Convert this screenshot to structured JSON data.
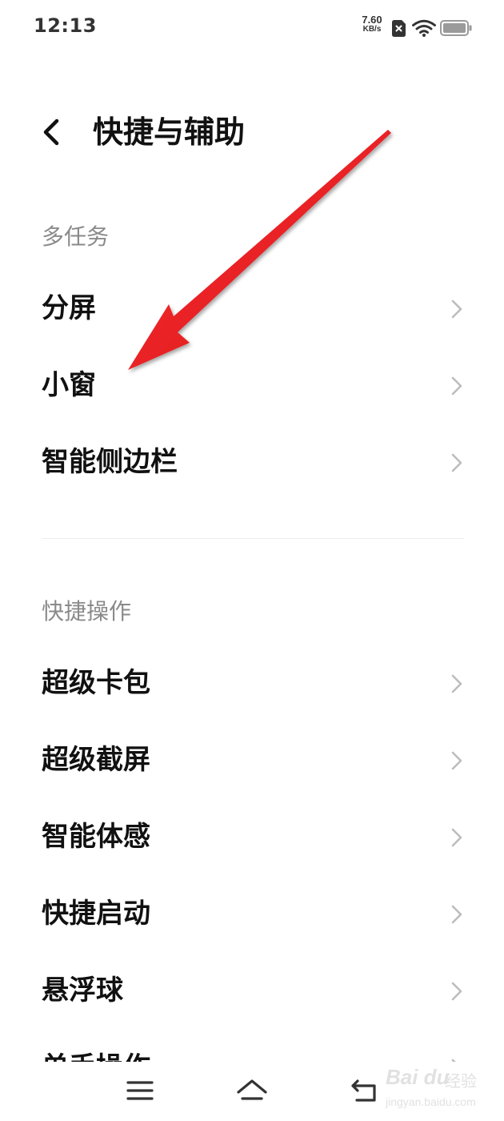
{
  "status_bar": {
    "time": "12:13",
    "net_speed_value": "7.60",
    "net_speed_unit": "KB/s",
    "icons": [
      "sim-no-card-icon",
      "wifi-icon",
      "battery-icon"
    ]
  },
  "header": {
    "title": "快捷与辅助",
    "back_icon": "chevron-left-icon"
  },
  "sections": [
    {
      "title": "多任务",
      "items": [
        {
          "label": "分屏"
        },
        {
          "label": "小窗"
        },
        {
          "label": "智能侧边栏"
        }
      ]
    },
    {
      "title": "快捷操作",
      "items": [
        {
          "label": "超级卡包"
        },
        {
          "label": "超级截屏"
        },
        {
          "label": "智能体感"
        },
        {
          "label": "快捷启动"
        },
        {
          "label": "悬浮球"
        },
        {
          "label": "单手操作"
        }
      ]
    }
  ],
  "annotation": {
    "color": "#e8141a",
    "icon": "red-arrow-annotation"
  },
  "nav_bar": {
    "icons": [
      "menu-icon",
      "home-icon",
      "back-icon"
    ]
  },
  "watermark": {
    "logo": "Bai du",
    "cn": "经验",
    "url": "jingyan.baidu.com"
  },
  "colors": {
    "background": "#ffffff",
    "text_primary": "#111111",
    "text_secondary": "#8a8a8a",
    "chevron": "#bdbdbd",
    "divider": "#ececec"
  }
}
